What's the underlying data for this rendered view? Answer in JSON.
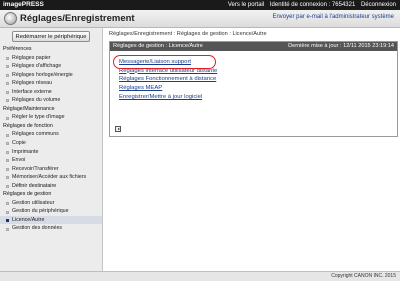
{
  "topbar": {
    "brand": "imagePRESS",
    "portal_link": "Vers le portail",
    "login_id": "Identité de connexion : 7654321",
    "logout": "Déconnexion"
  },
  "header": {
    "title": "Réglages/Enregistrement",
    "send_link": "Envoyer par e-mail à l'administrateur système"
  },
  "sidebar": {
    "restart_button": "Redémarrer le périphérique",
    "groups": [
      {
        "title": "Préférences",
        "items": [
          "Réglages papier",
          "Réglages d'affichage",
          "Réglages horloge/énergie",
          "Réglages réseau",
          "Interface externe",
          "Réglages du volume"
        ]
      },
      {
        "title": "Réglage/Maintenance",
        "items": [
          "Régler le type d'image"
        ]
      },
      {
        "title": "Réglages de fonction",
        "items": [
          "Réglages communs",
          "Copie",
          "Imprimante",
          "Envoi",
          "Recevoir/Transférer",
          "Mémoriser/Accéder aux fichiers"
        ]
      },
      {
        "title": "Définir destinataire",
        "items": []
      },
      {
        "title": "Réglages de gestion",
        "items": [
          "Gestion utilisateur",
          "Gestion du périphérique",
          "Licence/Autre",
          "Gestion des données"
        ]
      }
    ],
    "selected_item": "Licence/Autre"
  },
  "main": {
    "breadcrumb": "Réglages/Enregistrement : Réglages de gestion : Licence/Autre",
    "panel_title": "Réglages de gestion : Licence/Autre",
    "last_update": "Dernière mise à jour : 12/11 2015 23:19:14",
    "links": [
      "Messagerie/Liaison support",
      "Réglages interface utilisateur distante",
      "Réglages Fonctionnement à distance",
      "Réglages MEAP",
      "Enregistrer/Mettre à jour logiciel"
    ]
  },
  "footer": {
    "copyright": "Copyright CANON INC. 2015"
  },
  "colors": {
    "topbar": "#1a1a1a",
    "link": "#1a3d8f",
    "panel_header": "#555555",
    "highlight": "#e02020",
    "selection": "#d6dbe6"
  }
}
